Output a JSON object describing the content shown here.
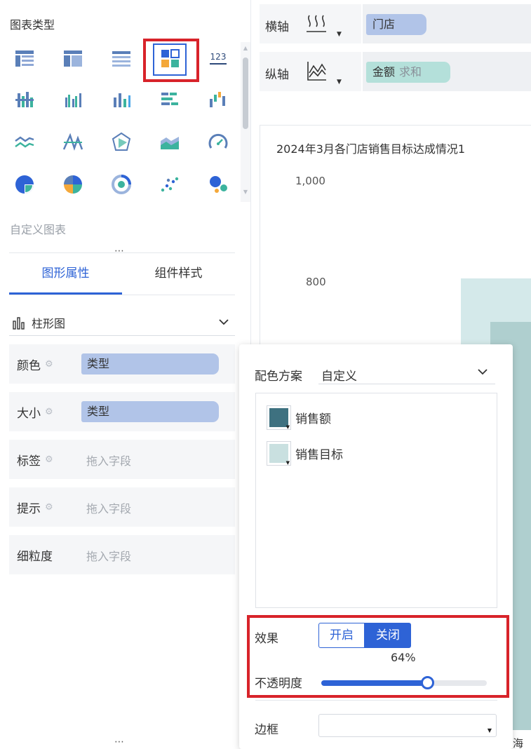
{
  "left_panel": {
    "chart_types_title": "图表类型",
    "custom_chart_label": "自定义图表",
    "drag_handle": "⋮",
    "tabs": [
      {
        "label": "图形属性",
        "active": true
      },
      {
        "label": "组件样式",
        "active": false
      }
    ],
    "chart_type_select": {
      "value": "柱形图"
    },
    "properties": [
      {
        "label": "颜色",
        "field": "类型"
      },
      {
        "label": "大小",
        "field": "类型"
      },
      {
        "label": "标签",
        "placeholder": "拖入字段"
      },
      {
        "label": "提示",
        "placeholder": "拖入字段"
      },
      {
        "label": "细粒度",
        "placeholder": "拖入字段"
      }
    ],
    "icon_grid_number_label": "123"
  },
  "axes": {
    "x": {
      "label": "横轴",
      "field": "门店"
    },
    "y": {
      "label": "纵轴",
      "field": "金额",
      "aggregation": "求和"
    }
  },
  "chart": {
    "title": "2024年3月各门店销售目标达成情况1",
    "y_ticks": [
      "1,000",
      "800"
    ],
    "x_category_partial": "海店"
  },
  "chart_data": {
    "type": "bar",
    "title": "2024年3月各门店销售目标达成情况1",
    "y_tick_labels": [
      "1,000",
      "800"
    ],
    "categories": [
      "海店"
    ],
    "series": [
      {
        "name": "销售目标",
        "values": [
          805
        ],
        "color": "#d4e9ea"
      },
      {
        "name": "销售额",
        "values": [
          720
        ],
        "color": "#afcfcf"
      }
    ]
  },
  "popup": {
    "scheme_label": "配色方案",
    "scheme_value": "自定义",
    "colors": [
      {
        "label": "销售额",
        "color": "#3e7180"
      },
      {
        "label": "销售目标",
        "color": "#c9e0e0"
      }
    ],
    "effect_label": "效果",
    "effect_on": "开启",
    "effect_off": "关闭",
    "effect_selected": "关闭",
    "opacity_label": "不透明度",
    "opacity_value": "64%",
    "opacity": 0.64,
    "border_label": "边框"
  },
  "colors": {
    "accent": "#2e63d6",
    "highlight_red": "#d8232a",
    "pill_blue": "#b1c4e8",
    "pill_teal": "#b4e0da"
  }
}
